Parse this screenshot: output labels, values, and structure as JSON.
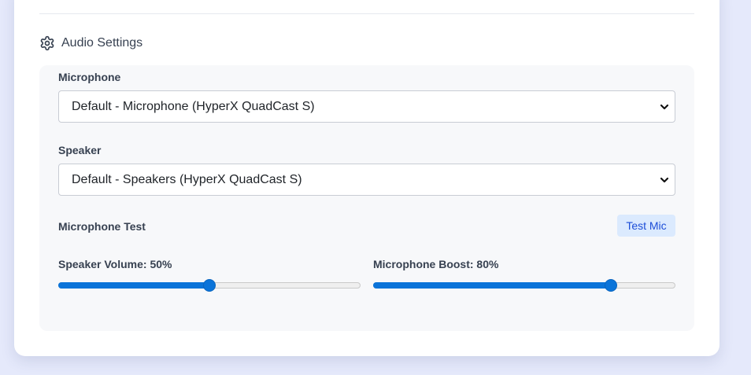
{
  "section": {
    "title": "Audio Settings",
    "icon": "gear-icon"
  },
  "microphone": {
    "label": "Microphone",
    "selected": "Default - Microphone (HyperX QuadCast S)"
  },
  "speaker": {
    "label": "Speaker",
    "selected": "Default - Speakers (HyperX QuadCast S)"
  },
  "mic_test": {
    "label": "Microphone Test",
    "button_label": "Test Mic"
  },
  "speaker_volume": {
    "label": "Speaker Volume: 50%",
    "value_percent": 50
  },
  "mic_boost": {
    "label": "Microphone Boost: 80%",
    "value_percent": 80
  },
  "colors": {
    "accent": "#0b74d9",
    "button_bg": "#dbeafe",
    "button_text": "#1d4ed8",
    "panel_bg": "#f7f8fa",
    "page_bg": "#e5e9fb"
  }
}
